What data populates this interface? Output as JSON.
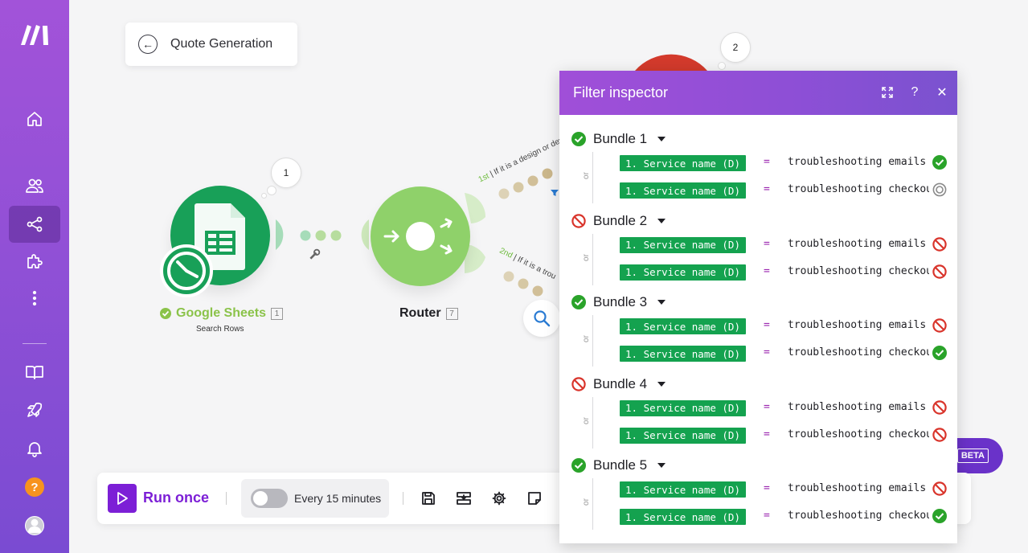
{
  "scenario": {
    "name": "Quote Generation"
  },
  "sidebar": {
    "items": [
      {
        "icon": "home-icon",
        "name": "sidebar-item-home"
      },
      {
        "icon": "users-icon",
        "name": "sidebar-item-team"
      },
      {
        "icon": "share-icon",
        "name": "sidebar-item-scenarios",
        "active": true
      },
      {
        "icon": "puzzle-icon",
        "name": "sidebar-item-apps"
      },
      {
        "icon": "more-icon",
        "name": "sidebar-item-more"
      },
      {
        "icon": "book-icon",
        "name": "sidebar-item-docs"
      },
      {
        "icon": "rocket-icon",
        "name": "sidebar-item-whats-new"
      },
      {
        "icon": "bell-icon",
        "name": "sidebar-item-notifications"
      },
      {
        "icon": "help-icon",
        "name": "sidebar-item-help"
      },
      {
        "icon": "avatar-icon",
        "name": "sidebar-item-profile"
      }
    ],
    "help_label": "?"
  },
  "modules": {
    "google_sheets": {
      "title": "Google Sheets",
      "subtitle": "Search Rows",
      "id": "1",
      "bubble": "1"
    },
    "router": {
      "title": "Router",
      "id": "7"
    },
    "next_bubble": "2"
  },
  "routes": [
    {
      "order": "1st",
      "label": "If it is a design or develop"
    },
    {
      "order": "2nd",
      "label": "If it is a trou"
    }
  ],
  "toolbar": {
    "run_label": "Run once",
    "schedule_label": "Every 15 minutes",
    "icons": [
      "save-icon",
      "explain-flow-icon",
      "settings-icon",
      "notes-icon"
    ]
  },
  "beta_label": "BETA",
  "inspector": {
    "title": "Filter inspector",
    "or_label": "or",
    "operator": "=",
    "bundles": [
      {
        "label": "Bundle 1",
        "status": "pass",
        "conditions": [
          {
            "field": "1. Service name (D)",
            "value": "troubleshooting emails",
            "status": "pass"
          },
          {
            "field": "1. Service name (D)",
            "value": "troubleshooting checkout",
            "status": "skipped"
          }
        ]
      },
      {
        "label": "Bundle 2",
        "status": "fail",
        "conditions": [
          {
            "field": "1. Service name (D)",
            "value": "troubleshooting emails",
            "status": "fail"
          },
          {
            "field": "1. Service name (D)",
            "value": "troubleshooting checkout",
            "status": "fail"
          }
        ]
      },
      {
        "label": "Bundle 3",
        "status": "pass",
        "conditions": [
          {
            "field": "1. Service name (D)",
            "value": "troubleshooting emails",
            "status": "fail"
          },
          {
            "field": "1. Service name (D)",
            "value": "troubleshooting checkout",
            "status": "pass"
          }
        ]
      },
      {
        "label": "Bundle 4",
        "status": "fail",
        "conditions": [
          {
            "field": "1. Service name (D)",
            "value": "troubleshooting emails",
            "status": "fail"
          },
          {
            "field": "1. Service name (D)",
            "value": "troubleshooting checkout",
            "status": "fail"
          }
        ]
      },
      {
        "label": "Bundle 5",
        "status": "pass",
        "conditions": [
          {
            "field": "1. Service name (D)",
            "value": "troubleshooting emails",
            "status": "fail"
          },
          {
            "field": "1. Service name (D)",
            "value": "troubleshooting checkout",
            "status": "pass"
          }
        ]
      }
    ]
  },
  "colors": {
    "pass": "#2aa32a",
    "fail": "#d9342b",
    "skipped": "#8a8a8a",
    "accent": "#7c1fd6",
    "tag": "#14a24f"
  }
}
